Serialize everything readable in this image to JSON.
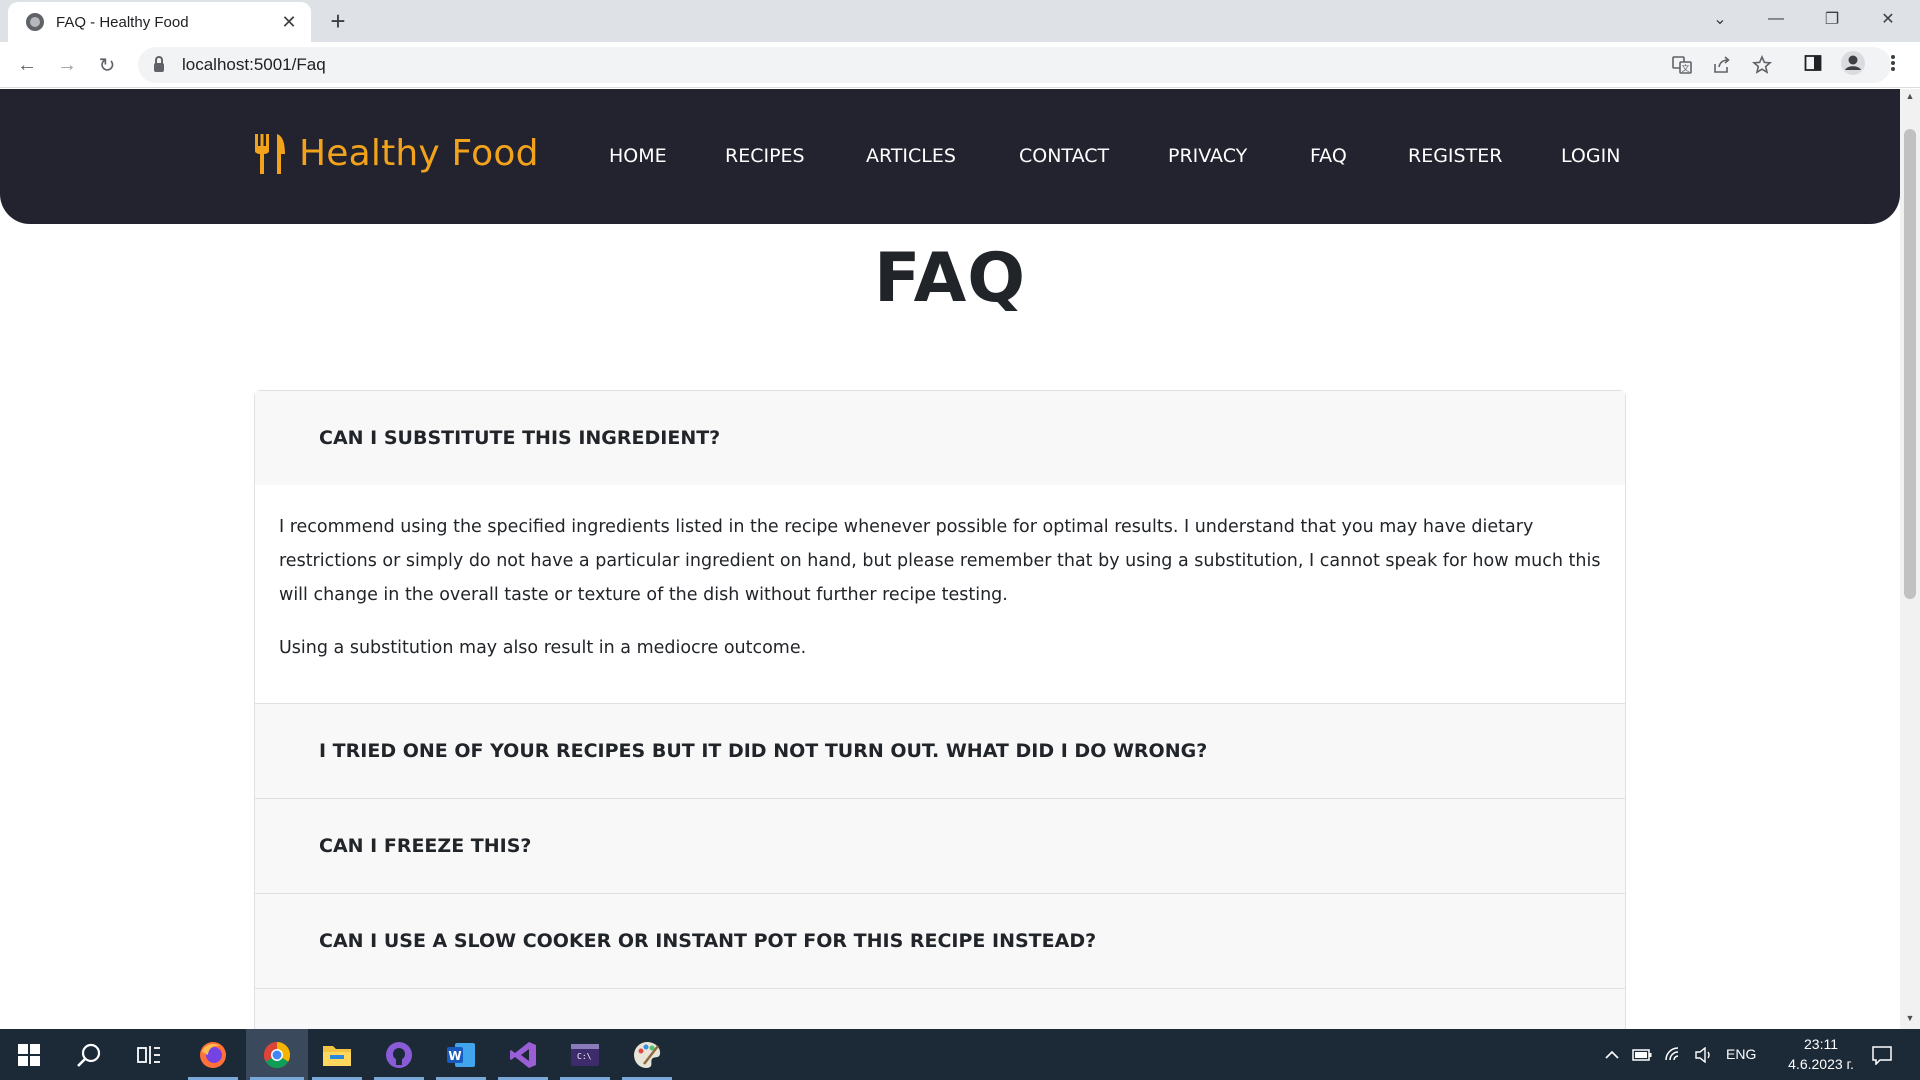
{
  "browser": {
    "tab_title": "FAQ - Healthy Food",
    "tab_close": "✕",
    "new_tab": "+",
    "url": "localhost:5001/Faq",
    "window_controls": {
      "chevron": "⌄",
      "minimize": "—",
      "restore": "❐",
      "close": "✕"
    },
    "nav": {
      "back": "←",
      "forward": "→",
      "reload": "↻"
    },
    "icons": [
      "translate-icon",
      "share-icon",
      "star-icon",
      "side-panel-icon",
      "profile-icon",
      "menu-icon"
    ]
  },
  "site": {
    "brand": "Healthy Food",
    "brand_color": "#f3a21c",
    "header_color": "#22232f",
    "nav": [
      "HOME",
      "RECIPES",
      "ARTICLES",
      "CONTACT",
      "PRIVACY",
      "FAQ",
      "REGISTER",
      "LOGIN"
    ]
  },
  "page": {
    "title": "FAQ",
    "faq": [
      {
        "question": "CAN I SUBSTITUTE THIS INGREDIENT?",
        "expanded": true,
        "answer": [
          "I recommend using the specified ingredients listed in the recipe whenever possible for optimal results. I understand that you may have dietary restrictions or simply do not have a particular ingredient on hand, but please remember that by using a substitution, I cannot speak for how much this will change in the overall taste or texture of the dish without further recipe testing.",
          "Using a substitution may also result in a mediocre outcome."
        ]
      },
      {
        "question": "I TRIED ONE OF YOUR RECIPES BUT IT DID NOT TURN OUT. WHAT DID I DO WRONG?",
        "expanded": false
      },
      {
        "question": "CAN I FREEZE THIS?",
        "expanded": false
      },
      {
        "question": "CAN I USE A SLOW COOKER OR INSTANT POT FOR THIS RECIPE INSTEAD?",
        "expanded": false
      }
    ]
  },
  "taskbar": {
    "apps": [
      "start-icon",
      "search-icon",
      "task-view-icon",
      "firefox-icon",
      "chrome-icon",
      "file-explorer-icon",
      "github-desktop-icon",
      "word-icon",
      "visual-studio-icon",
      "terminal-icon",
      "paint-icon"
    ],
    "language": "ENG",
    "time": "23:11",
    "date": "4.6.2023 г."
  }
}
